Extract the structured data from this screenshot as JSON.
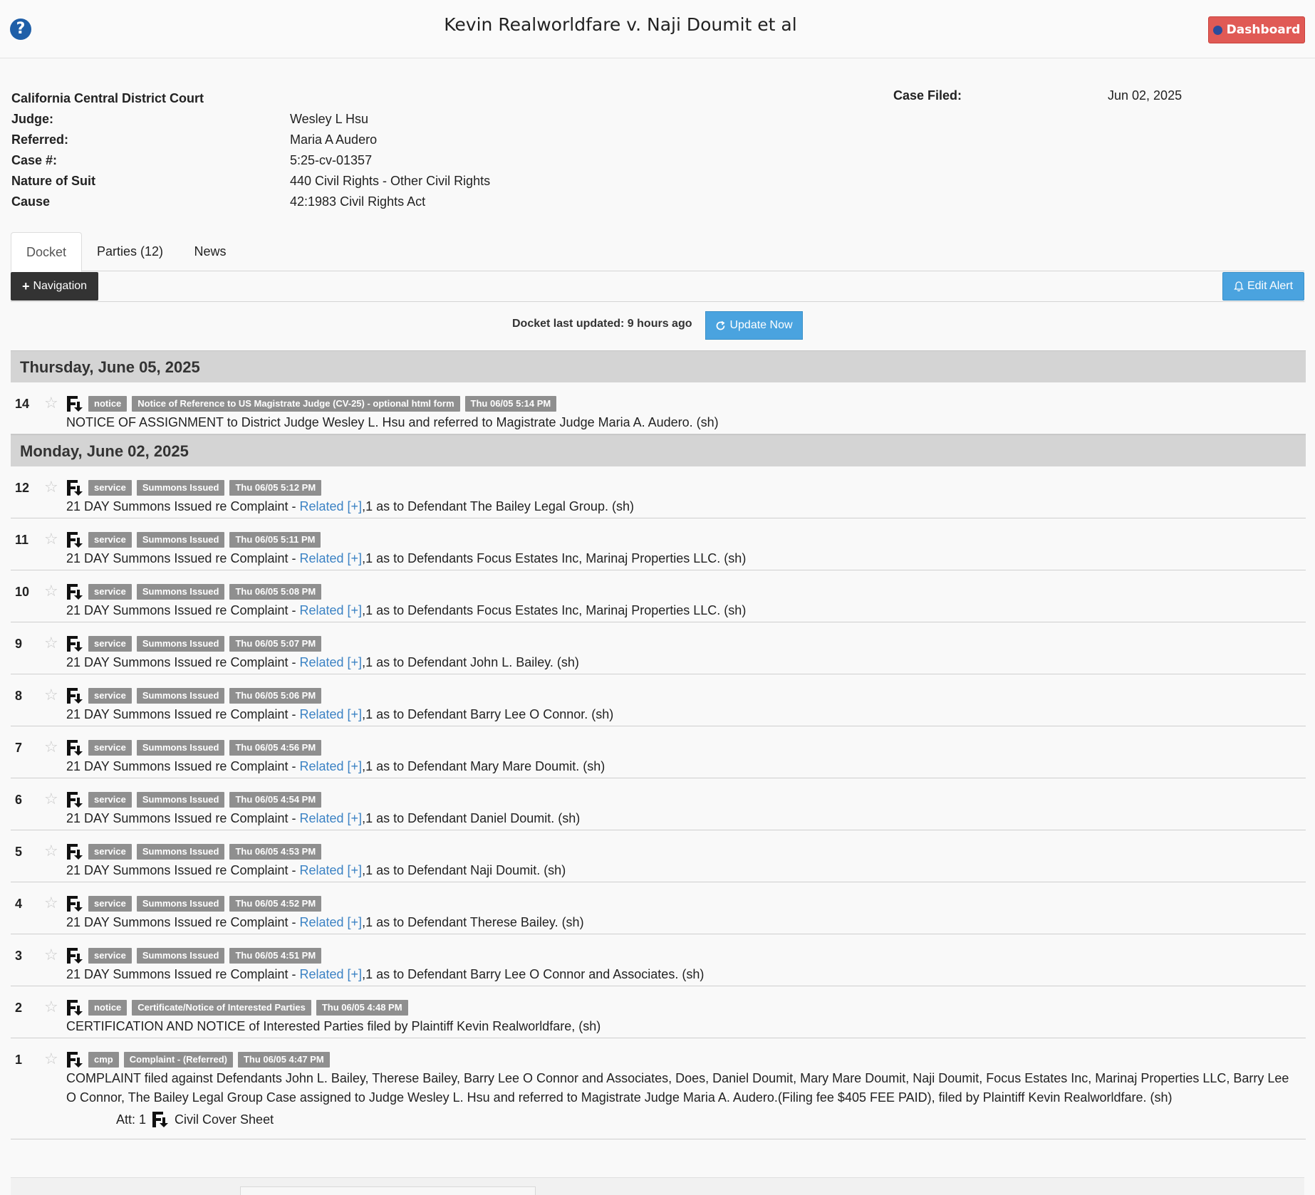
{
  "header": {
    "title": "Kevin Realworldfare v. Naji Doumit et al",
    "dashboard_label": "Dashboard"
  },
  "case": {
    "court": "California Central District Court",
    "judge_label": "Judge:",
    "judge": "Wesley L Hsu",
    "referred_label": "Referred:",
    "referred": "Maria A Audero",
    "case_no_label": "Case #:",
    "case_no": "5:25-cv-01357",
    "nature_label": "Nature of Suit",
    "nature": "440 Civil Rights - Other Civil Rights",
    "cause_label": "Cause",
    "cause": "42:1983 Civil Rights Act",
    "filed_label": "Case Filed:",
    "filed": "Jun 02, 2025"
  },
  "tabs": [
    {
      "label": "Docket"
    },
    {
      "label": "Parties (12)"
    },
    {
      "label": "News"
    }
  ],
  "toolbar": {
    "navigation_label": "Navigation",
    "edit_alert_label": "Edit Alert",
    "updated_text": "Docket last updated: 9 hours ago",
    "update_now_label": "Update Now"
  },
  "docket": {
    "related_label": "Related",
    "related_plus": "[+]",
    "days": [
      {
        "date": "Thursday, June 05, 2025",
        "entries": [
          {
            "num": "14",
            "tags": [
              "notice",
              "Notice of Reference to US Magistrate Judge (CV-25) - optional html form",
              "Thu 06/05 5:14 PM"
            ],
            "text": "NOTICE OF ASSIGNMENT to District Judge Wesley L. Hsu and referred to Magistrate Judge Maria A. Audero. (sh)"
          }
        ]
      },
      {
        "date": "Monday, June 02, 2025",
        "entries": [
          {
            "num": "12",
            "tags": [
              "service",
              "Summons Issued",
              "Thu 06/05 5:12 PM"
            ],
            "pre": "21 DAY Summons Issued re Complaint - ",
            "post": ",1 as to Defendant The Bailey Legal Group. (sh)"
          },
          {
            "num": "11",
            "tags": [
              "service",
              "Summons Issued",
              "Thu 06/05 5:11 PM"
            ],
            "pre": "21 DAY Summons Issued re Complaint - ",
            "post": ",1 as to Defendants Focus Estates Inc, Marinaj Properties LLC. (sh)"
          },
          {
            "num": "10",
            "tags": [
              "service",
              "Summons Issued",
              "Thu 06/05 5:08 PM"
            ],
            "pre": "21 DAY Summons Issued re Complaint - ",
            "post": ",1 as to Defendants Focus Estates Inc, Marinaj Properties LLC. (sh)"
          },
          {
            "num": "9",
            "tags": [
              "service",
              "Summons Issued",
              "Thu 06/05 5:07 PM"
            ],
            "pre": "21 DAY Summons Issued re Complaint - ",
            "post": ",1 as to Defendant John L. Bailey. (sh)"
          },
          {
            "num": "8",
            "tags": [
              "service",
              "Summons Issued",
              "Thu 06/05 5:06 PM"
            ],
            "pre": "21 DAY Summons Issued re Complaint - ",
            "post": ",1 as to Defendant Barry Lee O Connor. (sh)"
          },
          {
            "num": "7",
            "tags": [
              "service",
              "Summons Issued",
              "Thu 06/05 4:56 PM"
            ],
            "pre": "21 DAY Summons Issued re Complaint - ",
            "post": ",1 as to Defendant Mary Mare Doumit. (sh)"
          },
          {
            "num": "6",
            "tags": [
              "service",
              "Summons Issued",
              "Thu 06/05 4:54 PM"
            ],
            "pre": "21 DAY Summons Issued re Complaint - ",
            "post": ",1 as to Defendant Daniel Doumit. (sh)"
          },
          {
            "num": "5",
            "tags": [
              "service",
              "Summons Issued",
              "Thu 06/05 4:53 PM"
            ],
            "pre": "21 DAY Summons Issued re Complaint - ",
            "post": ",1 as to Defendant Naji Doumit. (sh)"
          },
          {
            "num": "4",
            "tags": [
              "service",
              "Summons Issued",
              "Thu 06/05 4:52 PM"
            ],
            "pre": "21 DAY Summons Issued re Complaint - ",
            "post": ",1 as to Defendant Therese Bailey. (sh)"
          },
          {
            "num": "3",
            "tags": [
              "service",
              "Summons Issued",
              "Thu 06/05 4:51 PM"
            ],
            "pre": "21 DAY Summons Issued re Complaint - ",
            "post": ",1 as to Defendant Barry Lee O Connor and Associates. (sh)"
          },
          {
            "num": "2",
            "tags": [
              "notice",
              "Certificate/Notice of Interested Parties",
              "Thu 06/05 4:48 PM"
            ],
            "text": "CERTIFICATION AND NOTICE of Interested Parties filed by Plaintiff Kevin Realworldfare, (sh)"
          },
          {
            "num": "1",
            "tags": [
              "cmp",
              "Complaint - (Referred)",
              "Thu 06/05 4:47 PM"
            ],
            "text": "COMPLAINT filed against Defendants John L. Bailey, Therese Bailey, Barry Lee O Connor and Associates, Does, Daniel Doumit, Mary Mare Doumit, Naji Doumit, Focus Estates Inc, Marinaj Properties LLC, Barry Lee O Connor, The Bailey Legal Group Case assigned to Judge Wesley L. Hsu and referred to Magistrate Judge Maria A. Audero.(Filing fee $405 FEE PAID), filed by Plaintiff Kevin Realworldfare. (sh)",
            "attachment": {
              "label": "Att: 1",
              "name": "Civil Cover Sheet"
            }
          }
        ]
      }
    ]
  }
}
